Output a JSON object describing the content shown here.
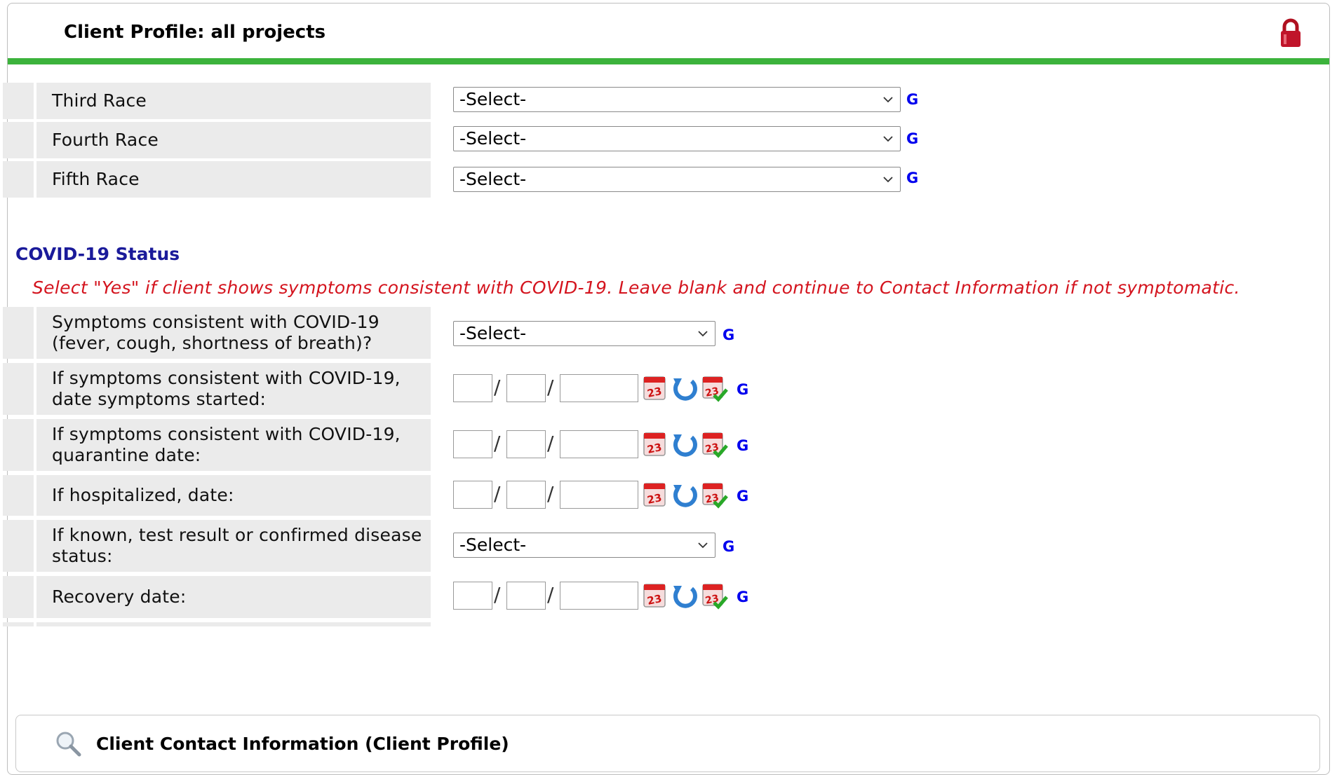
{
  "header": {
    "title": "Client Profile: all projects",
    "lock_icon": "lock-icon",
    "accent_color": "#3cb33c"
  },
  "race_rows": [
    {
      "label": "Third Race",
      "value": "-Select-",
      "g": "G"
    },
    {
      "label": "Fourth Race",
      "value": "-Select-",
      "g": "G"
    },
    {
      "label": "Fifth Race",
      "value": "-Select-",
      "g": "G"
    }
  ],
  "covid": {
    "title": "COVID-19 Status",
    "note": "Select \"Yes\" if client shows symptoms consistent with COVID-19. Leave blank and continue to Contact Information if not symptomatic.",
    "symptoms": {
      "label": "Symptoms consistent with COVID-19 (fever, cough, shortness of breath)?",
      "value": "-Select-",
      "g": "G"
    },
    "symptoms_started": {
      "label": "If symptoms consistent with COVID-19, date symptoms started:",
      "g": "G"
    },
    "quarantine": {
      "label": "If symptoms consistent with COVID-19, quarantine date:",
      "g": "G"
    },
    "hospitalized": {
      "label": "If hospitalized, date:",
      "g": "G"
    },
    "test_result": {
      "label": "If known, test result or confirmed disease status:",
      "value": "-Select-",
      "g": "G"
    },
    "recovery": {
      "label": "Recovery date:",
      "g": "G"
    }
  },
  "date_separator": "/",
  "icons": [
    "calendar-icon",
    "refresh-icon",
    "calendar-check-icon",
    "magnifier-icon",
    "lock-icon",
    "chevron-down-icon"
  ],
  "contact_panel": {
    "title": "Client Contact Information (Client Profile)"
  }
}
